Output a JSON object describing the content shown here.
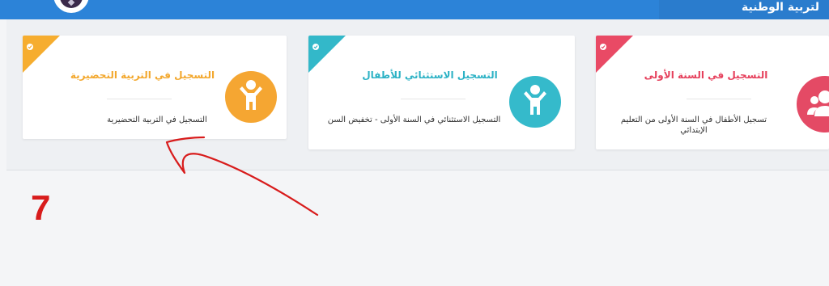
{
  "header": {
    "title": "لتربية الوطنية"
  },
  "cards": [
    {
      "title": "التسجيل في التربية التحضيرية",
      "description": "التسجيل في التربية التحضيرية",
      "icon": "child-icon",
      "accent": "#f5a632"
    },
    {
      "title": "التسجيل الاستثنائي للأطفال",
      "description": "التسجيل الاستثنائي في السنة الأولى - تخفيض السن",
      "icon": "child-icon",
      "accent": "#35bacb"
    },
    {
      "title": "التسجيل في السنة الأولى",
      "description": "تسجيل الأطفال في السنة الأولى من التعليم الإبتدائي",
      "icon": "users-icon",
      "accent": "#e44a65"
    }
  ],
  "annotation": {
    "step_number": "7",
    "color": "#d81c1c"
  }
}
